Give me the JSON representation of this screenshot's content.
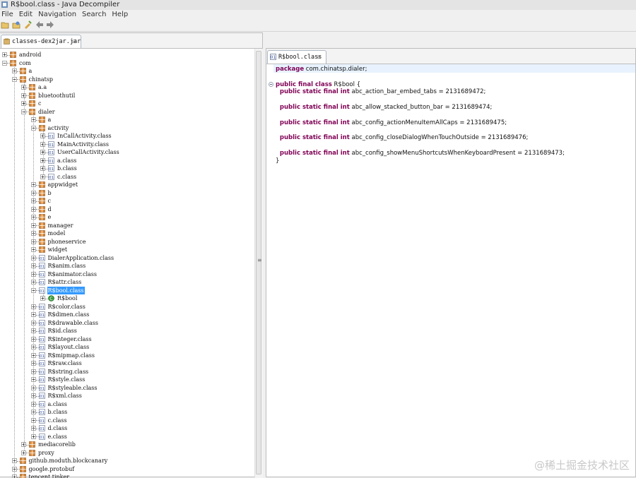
{
  "window": {
    "title": "R$bool.class - Java Decompiler"
  },
  "menu": [
    "File",
    "Edit",
    "Navigation",
    "Search",
    "Help"
  ],
  "toolbar": [
    {
      "name": "open-file-icon"
    },
    {
      "name": "open-type-icon"
    },
    {
      "name": "reload-icon"
    },
    {
      "name": "back-arrow-icon"
    },
    {
      "name": "forward-arrow-icon"
    }
  ],
  "left_tab": {
    "label": "classes-dex2jar.jar",
    "close": "☒"
  },
  "right_tab": {
    "label": "R$bool.class",
    "close": "☒"
  },
  "tree": [
    {
      "label": "android",
      "depth": 0,
      "kind": "package",
      "expander": "plus"
    },
    {
      "label": "com",
      "depth": 0,
      "kind": "package",
      "expander": "minus"
    },
    {
      "label": "a",
      "depth": 1,
      "kind": "package",
      "expander": "plus"
    },
    {
      "label": "chinatsp",
      "depth": 1,
      "kind": "package",
      "expander": "minus"
    },
    {
      "label": "a.a",
      "depth": 2,
      "kind": "package",
      "expander": "plus"
    },
    {
      "label": "bluetoothutil",
      "depth": 2,
      "kind": "package",
      "expander": "plus"
    },
    {
      "label": "c",
      "depth": 2,
      "kind": "package",
      "expander": "plus"
    },
    {
      "label": "dialer",
      "depth": 2,
      "kind": "package",
      "expander": "minus"
    },
    {
      "label": "a",
      "depth": 3,
      "kind": "package",
      "expander": "plus"
    },
    {
      "label": "activity",
      "depth": 3,
      "kind": "package",
      "expander": "minus"
    },
    {
      "label": "InCallActivity.class",
      "depth": 4,
      "kind": "class",
      "expander": "plus"
    },
    {
      "label": "MainActivity.class",
      "depth": 4,
      "kind": "class",
      "expander": "plus"
    },
    {
      "label": "UserCallActivity.class",
      "depth": 4,
      "kind": "class",
      "expander": "plus"
    },
    {
      "label": "a.class",
      "depth": 4,
      "kind": "class",
      "expander": "plus"
    },
    {
      "label": "b.class",
      "depth": 4,
      "kind": "class",
      "expander": "plus"
    },
    {
      "label": "c.class",
      "depth": 4,
      "kind": "class",
      "expander": "plus"
    },
    {
      "label": "appwidget",
      "depth": 3,
      "kind": "package",
      "expander": "plus"
    },
    {
      "label": "b",
      "depth": 3,
      "kind": "package",
      "expander": "plus"
    },
    {
      "label": "c",
      "depth": 3,
      "kind": "package",
      "expander": "plus"
    },
    {
      "label": "d",
      "depth": 3,
      "kind": "package",
      "expander": "plus"
    },
    {
      "label": "e",
      "depth": 3,
      "kind": "package",
      "expander": "plus"
    },
    {
      "label": "manager",
      "depth": 3,
      "kind": "package",
      "expander": "plus"
    },
    {
      "label": "model",
      "depth": 3,
      "kind": "package",
      "expander": "plus"
    },
    {
      "label": "phoneservice",
      "depth": 3,
      "kind": "package",
      "expander": "plus"
    },
    {
      "label": "widget",
      "depth": 3,
      "kind": "package",
      "expander": "plus"
    },
    {
      "label": "DialerApplication.class",
      "depth": 3,
      "kind": "class",
      "expander": "plus"
    },
    {
      "label": "R$anim.class",
      "depth": 3,
      "kind": "class",
      "expander": "plus"
    },
    {
      "label": "R$animator.class",
      "depth": 3,
      "kind": "class",
      "expander": "plus"
    },
    {
      "label": "R$attr.class",
      "depth": 3,
      "kind": "class",
      "expander": "plus"
    },
    {
      "label": "R$bool.class",
      "depth": 3,
      "kind": "class",
      "expander": "minus",
      "selected": true
    },
    {
      "label": "R$bool",
      "depth": 4,
      "kind": "type",
      "expander": "plus"
    },
    {
      "label": "R$color.class",
      "depth": 3,
      "kind": "class",
      "expander": "plus"
    },
    {
      "label": "R$dimen.class",
      "depth": 3,
      "kind": "class",
      "expander": "plus"
    },
    {
      "label": "R$drawable.class",
      "depth": 3,
      "kind": "class",
      "expander": "plus"
    },
    {
      "label": "R$id.class",
      "depth": 3,
      "kind": "class",
      "expander": "plus"
    },
    {
      "label": "R$integer.class",
      "depth": 3,
      "kind": "class",
      "expander": "plus"
    },
    {
      "label": "R$layout.class",
      "depth": 3,
      "kind": "class",
      "expander": "plus"
    },
    {
      "label": "R$mipmap.class",
      "depth": 3,
      "kind": "class",
      "expander": "plus"
    },
    {
      "label": "R$raw.class",
      "depth": 3,
      "kind": "class",
      "expander": "plus"
    },
    {
      "label": "R$string.class",
      "depth": 3,
      "kind": "class",
      "expander": "plus"
    },
    {
      "label": "R$style.class",
      "depth": 3,
      "kind": "class",
      "expander": "plus"
    },
    {
      "label": "R$styleable.class",
      "depth": 3,
      "kind": "class",
      "expander": "plus"
    },
    {
      "label": "R$xml.class",
      "depth": 3,
      "kind": "class",
      "expander": "plus"
    },
    {
      "label": "a.class",
      "depth": 3,
      "kind": "class",
      "expander": "plus"
    },
    {
      "label": "b.class",
      "depth": 3,
      "kind": "class",
      "expander": "plus"
    },
    {
      "label": "c.class",
      "depth": 3,
      "kind": "class",
      "expander": "plus"
    },
    {
      "label": "d.class",
      "depth": 3,
      "kind": "class",
      "expander": "plus"
    },
    {
      "label": "e.class",
      "depth": 3,
      "kind": "class",
      "expander": "plus"
    },
    {
      "label": "mediacorelib",
      "depth": 2,
      "kind": "package",
      "expander": "plus"
    },
    {
      "label": "proxy",
      "depth": 2,
      "kind": "package",
      "expander": "plus"
    },
    {
      "label": "github.moduth.blockcanary",
      "depth": 1,
      "kind": "package",
      "expander": "plus"
    },
    {
      "label": "google.protobuf",
      "depth": 1,
      "kind": "package",
      "expander": "plus"
    },
    {
      "label": "tencent.tinker",
      "depth": 1,
      "kind": "package",
      "expander": "plus"
    }
  ],
  "code": [
    {
      "kw": "package",
      "text": " com.chinatsp.dialer;",
      "fold": false
    },
    {
      "kw": "",
      "text": "",
      "fold": false
    },
    {
      "kw": "public final class",
      "text": " R$bool {",
      "fold": true
    },
    {
      "kw": "  public static final int",
      "text": " abc_action_bar_embed_tabs = 2131689472;",
      "fold": false
    },
    {
      "kw": "",
      "text": "",
      "fold": false
    },
    {
      "kw": "  public static final int",
      "text": " abc_allow_stacked_button_bar = 2131689474;",
      "fold": false
    },
    {
      "kw": "",
      "text": "",
      "fold": false
    },
    {
      "kw": "  public static final int",
      "text": " abc_config_actionMenuItemAllCaps = 2131689475;",
      "fold": false
    },
    {
      "kw": "",
      "text": "",
      "fold": false
    },
    {
      "kw": "  public static final int",
      "text": " abc_config_closeDialogWhenTouchOutside = 2131689476;",
      "fold": false
    },
    {
      "kw": "",
      "text": "",
      "fold": false
    },
    {
      "kw": "  public static final int",
      "text": " abc_config_showMenuShortcutsWhenKeyboardPresent = 2131689473;",
      "fold": false
    },
    {
      "kw": "",
      "text": "}",
      "fold": false
    }
  ],
  "watermark": "@稀土掘金技术社区",
  "colors": {
    "keyword": "#7f0055",
    "selection": "#3399ff",
    "package_icon": "#b5651d"
  }
}
